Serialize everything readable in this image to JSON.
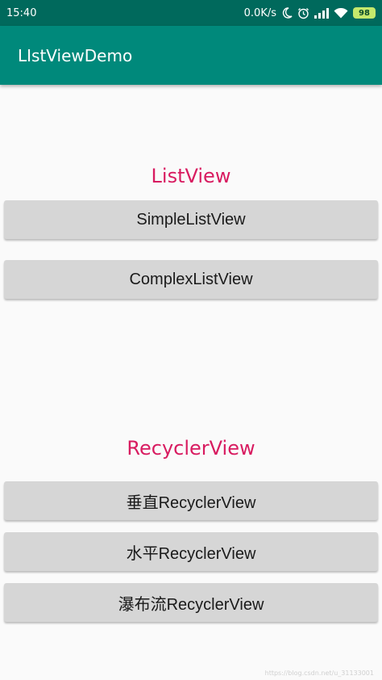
{
  "status_bar": {
    "time": "15:40",
    "speed": "0.0K/s",
    "battery": "98",
    "icons": [
      "moon-icon",
      "alarm-icon",
      "signal-icon",
      "wifi-icon",
      "battery-icon"
    ]
  },
  "app_bar": {
    "title": "LIstViewDemo",
    "color": "#00897b"
  },
  "listview": {
    "title": "ListView",
    "buttons": [
      "SimpleListView",
      "ComplexListView"
    ]
  },
  "recyclerview": {
    "title": "RecyclerView",
    "buttons": [
      "垂直RecyclerView",
      "水平RecyclerView",
      "瀑布流RecyclerView"
    ]
  },
  "watermark": "https://blog.csdn.net/u_31133001",
  "colors": {
    "accent": "#d81b60",
    "status_bar": "#00695c",
    "button": "#d6d6d6"
  }
}
